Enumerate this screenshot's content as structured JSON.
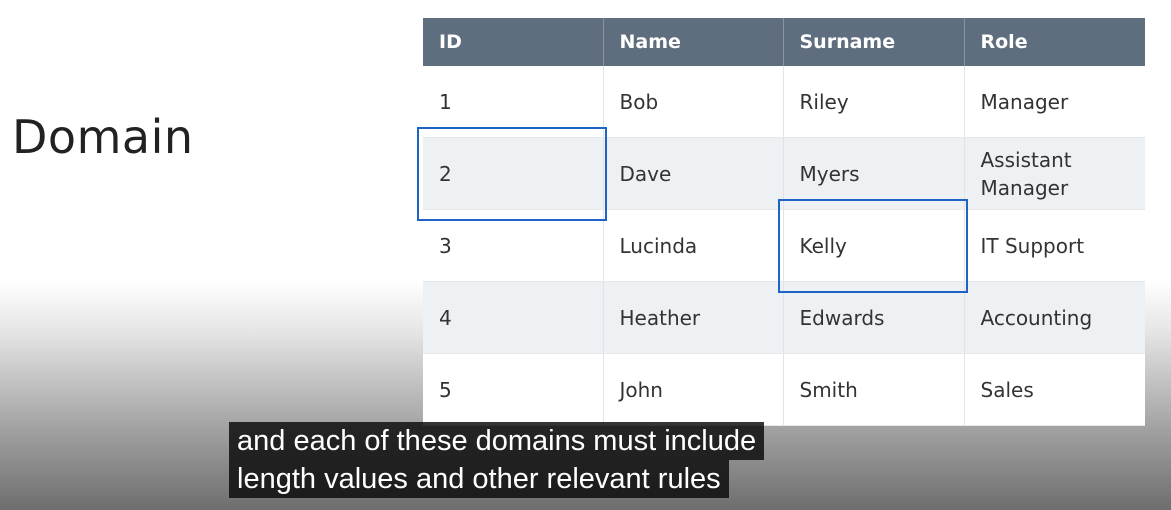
{
  "slide": {
    "title": "Domain"
  },
  "table": {
    "headers": [
      "ID",
      "Name",
      "Surname",
      "Role"
    ],
    "rows": [
      [
        "1",
        "Bob",
        "Riley",
        "Manager"
      ],
      [
        "2",
        "Dave",
        "Myers",
        "Assistant Manager"
      ],
      [
        "3",
        "Lucinda",
        "Kelly",
        "IT Support"
      ],
      [
        "4",
        "Heather",
        "Edwards",
        "Accounting"
      ],
      [
        "5",
        "John",
        "Smith",
        "Sales"
      ]
    ],
    "highlighted_cells": [
      {
        "row": 2,
        "column": "ID"
      },
      {
        "row": 3,
        "column": "Surname"
      }
    ]
  },
  "captions": {
    "line1": "and each of these domains must include",
    "line2": "length values and other relevant rules"
  },
  "colors": {
    "header_bg": "#5f6e7e",
    "highlight": "#1f63c7",
    "row_alt_bg": "#eef1f4"
  }
}
